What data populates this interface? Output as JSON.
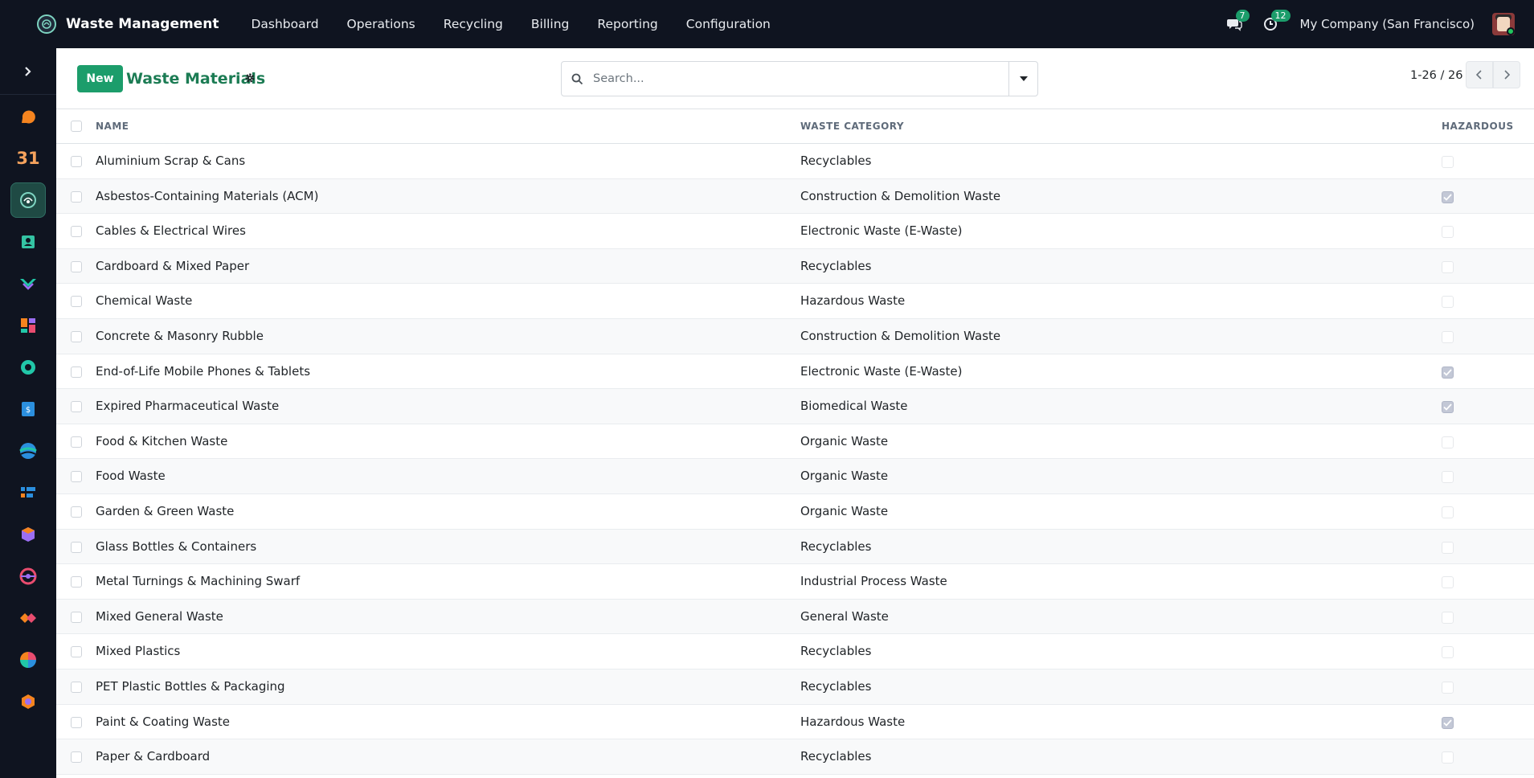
{
  "app": {
    "title": "Waste Management",
    "menu": [
      "Dashboard",
      "Operations",
      "Recycling",
      "Billing",
      "Reporting",
      "Configuration"
    ],
    "messages_count": "7",
    "activities_count": "12",
    "company": "My Company (San Francisco)"
  },
  "sidebar": {
    "apps": [
      "discuss-icon",
      "calendar-icon",
      "waste-management-icon",
      "contacts-icon",
      "crm-icon",
      "dashboards-icon",
      "helpdesk-icon",
      "invoicing-icon",
      "website-icon",
      "project-icon",
      "inventory-icon",
      "fleet-icon",
      "planning-icon",
      "spreadsheet-icon",
      "repair-icon"
    ],
    "calendar_label": "31"
  },
  "control": {
    "new_label": "New",
    "page_title": "Waste Materials",
    "search_placeholder": "Search...",
    "pager": "1-26 / 26"
  },
  "table": {
    "columns": {
      "name": "NAME",
      "category": "WASTE CATEGORY",
      "hazardous": "HAZARDOUS"
    },
    "rows": [
      {
        "name": "Aluminium Scrap & Cans",
        "category": "Recyclables",
        "hazardous": false
      },
      {
        "name": "Asbestos-Containing Materials (ACM)",
        "category": "Construction & Demolition Waste",
        "hazardous": true
      },
      {
        "name": "Cables & Electrical Wires",
        "category": "Electronic Waste (E-Waste)",
        "hazardous": false
      },
      {
        "name": "Cardboard & Mixed Paper",
        "category": "Recyclables",
        "hazardous": false
      },
      {
        "name": "Chemical Waste",
        "category": "Hazardous Waste",
        "hazardous": false
      },
      {
        "name": "Concrete & Masonry Rubble",
        "category": "Construction & Demolition Waste",
        "hazardous": false
      },
      {
        "name": "End-of-Life Mobile Phones & Tablets",
        "category": "Electronic Waste (E-Waste)",
        "hazardous": true
      },
      {
        "name": "Expired Pharmaceutical Waste",
        "category": "Biomedical Waste",
        "hazardous": true
      },
      {
        "name": "Food & Kitchen Waste",
        "category": "Organic Waste",
        "hazardous": false
      },
      {
        "name": "Food Waste",
        "category": "Organic Waste",
        "hazardous": false
      },
      {
        "name": "Garden & Green Waste",
        "category": "Organic Waste",
        "hazardous": false
      },
      {
        "name": "Glass Bottles & Containers",
        "category": "Recyclables",
        "hazardous": false
      },
      {
        "name": "Metal Turnings & Machining Swarf",
        "category": "Industrial Process Waste",
        "hazardous": false
      },
      {
        "name": "Mixed General Waste",
        "category": "General Waste",
        "hazardous": false
      },
      {
        "name": "Mixed Plastics",
        "category": "Recyclables",
        "hazardous": false
      },
      {
        "name": "PET Plastic Bottles & Packaging",
        "category": "Recyclables",
        "hazardous": false
      },
      {
        "name": "Paint & Coating Waste",
        "category": "Hazardous Waste",
        "hazardous": true
      },
      {
        "name": "Paper & Cardboard",
        "category": "Recyclables",
        "hazardous": false
      }
    ]
  }
}
